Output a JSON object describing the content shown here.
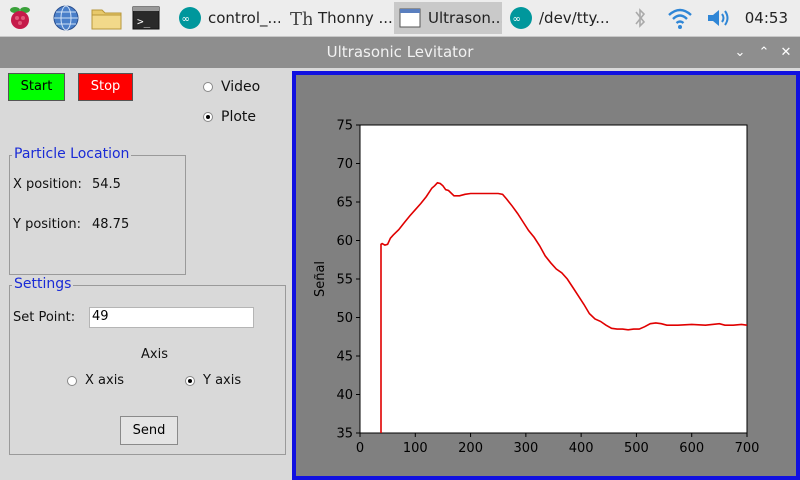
{
  "taskbar": {
    "tasks": [
      {
        "label": "control_...",
        "icon": "arduino-icon"
      },
      {
        "label": "Thonny  ...",
        "icon": "thonny-icon"
      },
      {
        "label": "Ultrason...",
        "icon": "window-icon"
      },
      {
        "label": "/dev/tty...",
        "icon": "arduino-icon"
      }
    ],
    "clock": "04:53"
  },
  "window": {
    "title": "Ultrasonic Levitator"
  },
  "controls": {
    "start_label": "Start",
    "stop_label": "Stop",
    "mode_video": "Video",
    "mode_plot": "Plote",
    "selected_mode": "Plote"
  },
  "particle": {
    "title": "Particle Location",
    "x_label": "X position:",
    "x_value": "54.5",
    "y_label": "Y position:",
    "y_value": "48.75"
  },
  "settings": {
    "title": "Settings",
    "setpoint_label": "Set Point:",
    "setpoint_value": "49",
    "axis_label": "Axis",
    "x_axis": "X axis",
    "y_axis": "Y axis",
    "selected_axis": "Y axis",
    "send_label": "Send"
  },
  "colors": {
    "start": "#00ff00",
    "stop": "#ff0000",
    "plot_border": "#1010e0",
    "series": "#e00000"
  },
  "chart_data": {
    "type": "line",
    "title": "",
    "xlabel": "",
    "ylabel": "Señal",
    "xlim": [
      0,
      700
    ],
    "ylim": [
      35,
      75
    ],
    "xticks": [
      0,
      100,
      200,
      300,
      400,
      500,
      600,
      700
    ],
    "yticks": [
      35,
      40,
      45,
      50,
      55,
      60,
      65,
      70,
      75
    ],
    "grid": false,
    "series": [
      {
        "x": [
          38,
          38,
          40,
          45,
          50,
          55,
          60,
          70,
          80,
          90,
          100,
          110,
          120,
          130,
          135,
          140,
          145,
          150,
          155,
          160,
          170,
          180,
          190,
          200,
          210,
          220,
          230,
          240,
          250,
          258,
          265,
          275,
          285,
          295,
          305,
          315,
          325,
          335,
          345,
          355,
          365,
          375,
          385,
          395,
          405,
          415,
          425,
          435,
          445,
          455,
          465,
          475,
          485,
          495,
          505,
          515,
          525,
          535,
          545,
          555,
          575,
          600,
          625,
          650,
          660,
          675,
          690,
          700
        ],
        "y": [
          35,
          59.5,
          59.6,
          59.4,
          59.5,
          60.3,
          60.7,
          61.4,
          62.3,
          63.2,
          64.0,
          64.8,
          65.7,
          66.8,
          67.1,
          67.5,
          67.4,
          67.1,
          66.6,
          66.5,
          65.8,
          65.8,
          66.0,
          66.1,
          66.1,
          66.1,
          66.1,
          66.1,
          66.1,
          66.0,
          65.4,
          64.5,
          63.5,
          62.4,
          61.3,
          60.4,
          59.3,
          58.0,
          57.1,
          56.3,
          55.8,
          55.0,
          53.9,
          52.8,
          51.7,
          50.5,
          49.8,
          49.5,
          49.0,
          48.6,
          48.5,
          48.5,
          48.4,
          48.5,
          48.5,
          48.8,
          49.2,
          49.3,
          49.2,
          49.0,
          49.0,
          49.1,
          49.0,
          49.2,
          49.0,
          49.0,
          49.1,
          49.0
        ]
      }
    ]
  }
}
